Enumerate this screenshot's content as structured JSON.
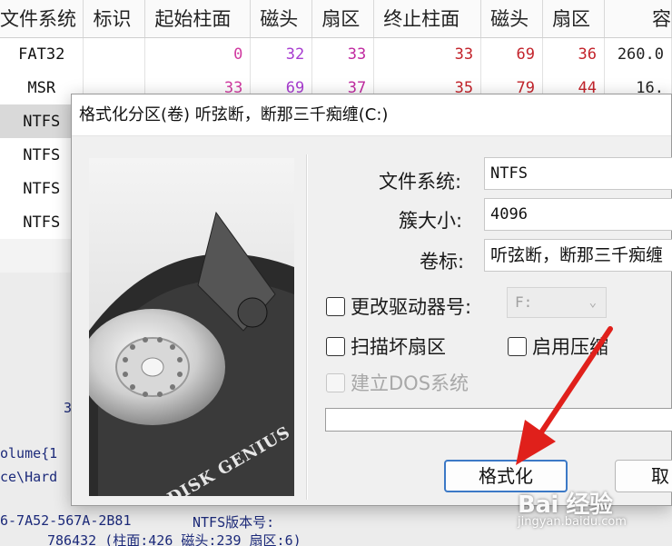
{
  "table": {
    "headers": [
      "文件系统",
      "标识",
      "起始柱面",
      "磁头",
      "扇区",
      "终止柱面",
      "磁头",
      "扇区",
      "容"
    ],
    "rows": [
      {
        "fs": "FAT32",
        "start_cyl": "0",
        "head1": "32",
        "sec1": "33",
        "end_cyl": "33",
        "head2": "69",
        "sec2": "36",
        "cap": "260.0"
      },
      {
        "fs": "MSR",
        "start_cyl": "33",
        "head1": "69",
        "sec1": "37",
        "end_cyl": "35",
        "head2": "79",
        "sec2": "44",
        "cap": "16."
      },
      {
        "fs": "NTFS"
      },
      {
        "fs": "NTFS"
      },
      {
        "fs": "NTFS"
      },
      {
        "fs": "NTFS"
      }
    ]
  },
  "background_text": {
    "digit": "3",
    "volume": "olume{1",
    "hard": "ce\\Hard",
    "guid": "6-7A52-567A-2B81",
    "ntfs_ver": "NTFS版本号:",
    "sector_info": "786432 (柱面:426 磁头:239 扇区:6)"
  },
  "dialog": {
    "title": "格式化分区(卷) 听弦断，断那三千痴缠(C:)",
    "art_text": "DISK GENIUS",
    "fs_label": "文件系统:",
    "fs_value": "NTFS",
    "cluster_label": "簇大小:",
    "cluster_value": "4096",
    "volume_label": "卷标:",
    "volume_value": "听弦断，断那三千痴缠",
    "change_drive_label": "更改驱动器号:",
    "drive_value": "F:",
    "scan_bad_label": "扫描坏扇区",
    "compress_label": "启用压缩",
    "dos_label": "建立DOS系统",
    "format_button": "格式化",
    "cancel_button": "取"
  },
  "watermark": {
    "logo": "Bai 经验",
    "url": "jingyan.baidu.com"
  },
  "colors": {
    "arrow": "#e0201b",
    "primary_border": "#3c79c6"
  }
}
